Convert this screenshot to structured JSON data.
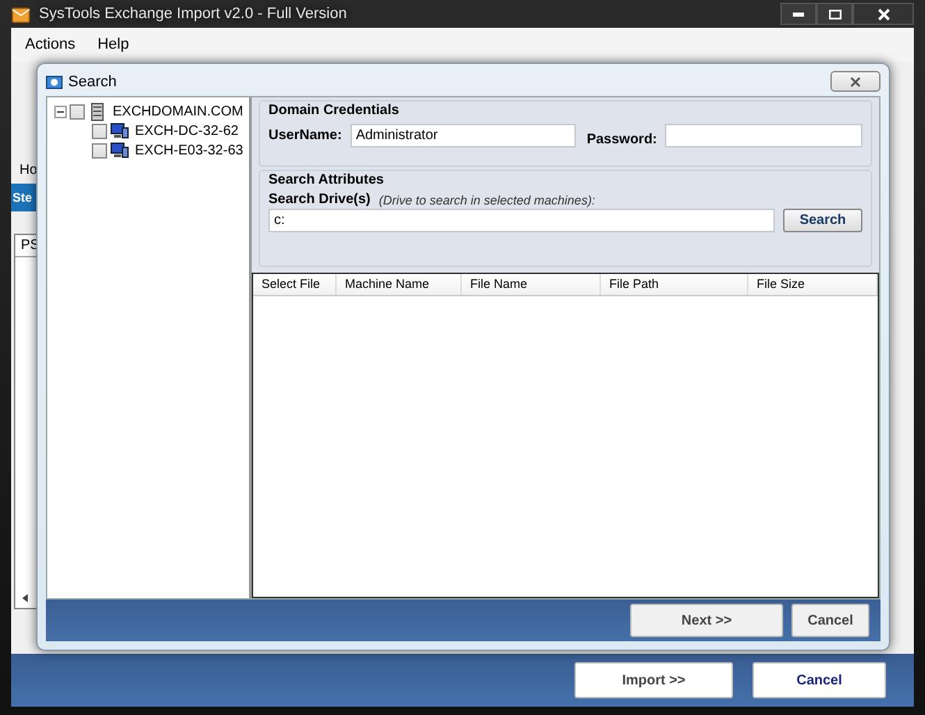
{
  "window": {
    "title": "SysTools Exchange Import v2.0 - Full Version"
  },
  "menu": [
    "Actions",
    "Help"
  ],
  "background": {
    "texts": [
      "Ho",
      "Ste",
      "PS"
    ],
    "buttons": [
      "Import >>",
      "Cancel"
    ]
  },
  "dialog": {
    "title": "Search",
    "tree": [
      {
        "label": "EXCHDOMAIN.COM",
        "kind": "domain",
        "checked": false,
        "expanded": true,
        "children": [
          {
            "label": "EXCH-DC-32-62",
            "kind": "machine",
            "checked": false
          },
          {
            "label": "EXCH-E03-32-63",
            "kind": "machine",
            "checked": false
          }
        ]
      }
    ],
    "credentials": {
      "title": "Domain Credentials",
      "username_label": "UserName:",
      "username": "Administrator",
      "password_label": "Password:"
    },
    "search_attributes": {
      "title": "Search Attributes",
      "drive_label": "Search Drive(s)",
      "drive_hint": "(Drive to search in selected machines):",
      "drive": "c:",
      "button": "Search"
    },
    "table": {
      "columns": [
        "Select File",
        "Machine Name",
        "File Name",
        "File Path",
        "File Size"
      ]
    },
    "buttons": [
      "Next >>",
      "Cancel"
    ]
  }
}
